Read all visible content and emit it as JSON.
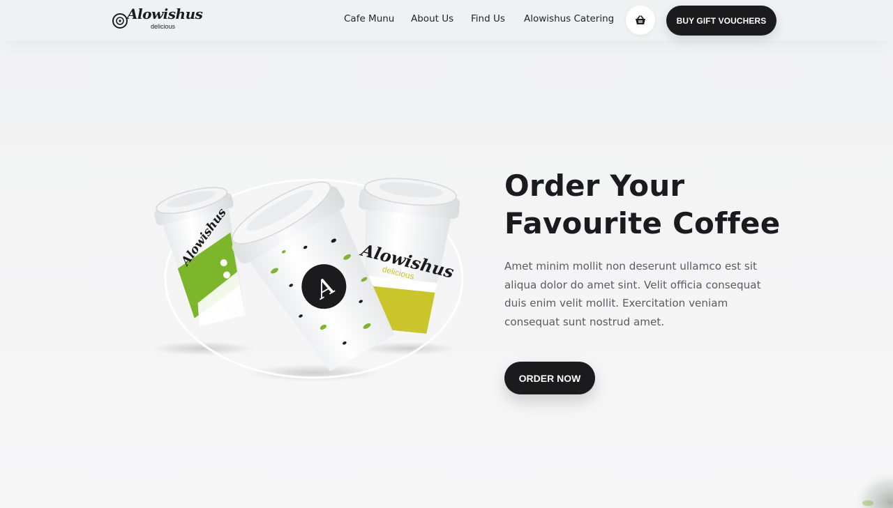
{
  "brand": {
    "name": "Alowishus",
    "tagline": "delicious"
  },
  "nav": {
    "links": [
      "Cafe Munu",
      "About Us",
      "Find Us",
      "Alowishus Catering"
    ],
    "cart_icon": "basket-icon",
    "gift_button": "BUY GIFT VOUCHERS"
  },
  "hero": {
    "title_line1": "Order Your",
    "title_line2": "Favourite Coffee",
    "description": "Amet minim mollit non deserunt ullamco est sit aliqua dolor do amet sint. Velit officia consequat duis enim velit mollit. Exercitation veniam consequat sunt nostrud amet.",
    "order_button": "ORDER NOW"
  },
  "colors": {
    "primary_dark": "#1b1b1d",
    "accent_green": "#7cb62a",
    "accent_lime": "#c9c52b",
    "background": "#f3f3f4"
  }
}
